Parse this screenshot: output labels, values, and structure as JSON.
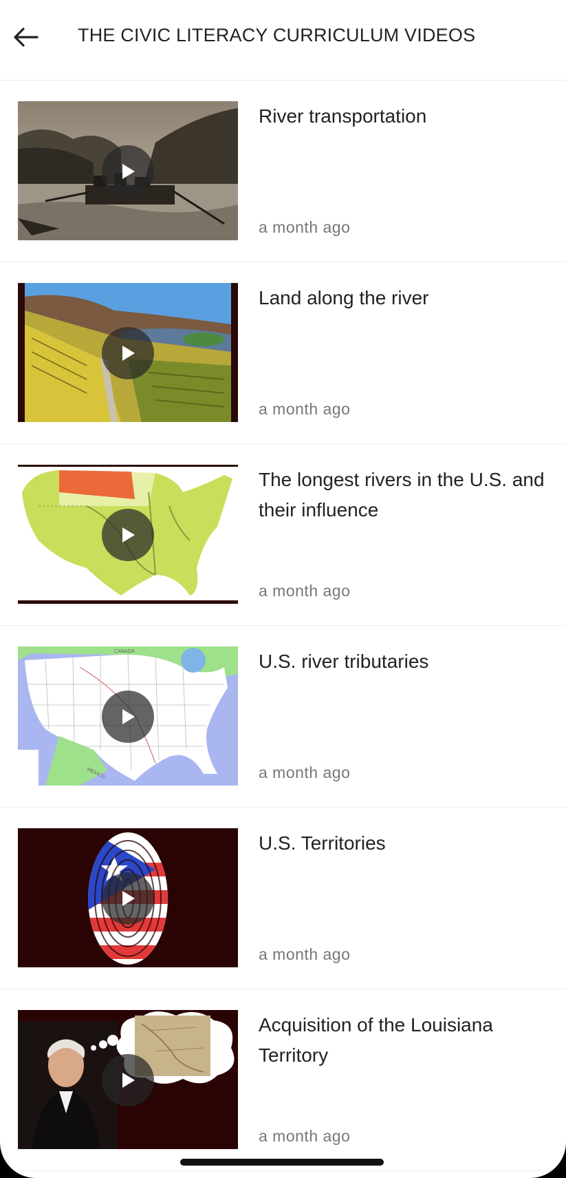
{
  "header": {
    "back_icon": "arrow-left-icon",
    "title": "THE CIVIC LITERACY CURRICULUM VIDEOS"
  },
  "videos": [
    {
      "title": "River transportation",
      "time": "a month ago",
      "thumbnail": "river-boat-engraving"
    },
    {
      "title": "Land along the river",
      "time": "a month ago",
      "thumbnail": "vineyard-river-valley"
    },
    {
      "title": "The longest rivers in the U.S. and their influence",
      "time": "a month ago",
      "thumbnail": "us-rivers-map"
    },
    {
      "title": "U.S. river tributaries",
      "time": "a month ago",
      "thumbnail": "us-political-map"
    },
    {
      "title": "U.S. Territories",
      "time": "a month ago",
      "thumbnail": "puerto-rico-flag-fingerprint"
    },
    {
      "title": "Acquisition of the Louisiana Territory",
      "time": "a month ago",
      "thumbnail": "jefferson-thinking-of-map"
    }
  ],
  "thumbnail_map_labels": {
    "canada": "CANADA",
    "mexico": "MEXICO"
  }
}
